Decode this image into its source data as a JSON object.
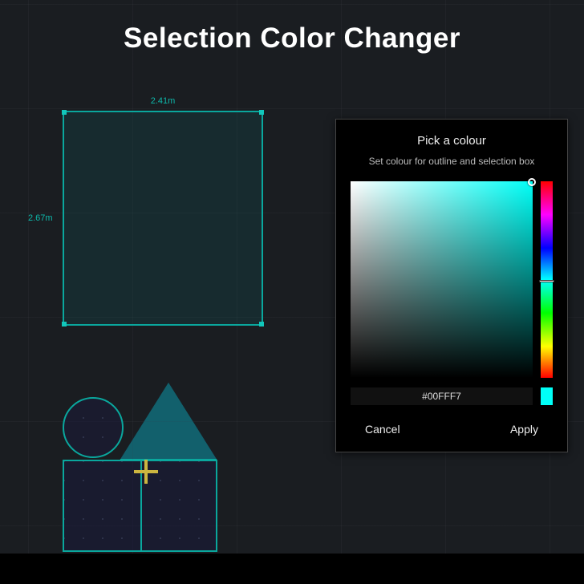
{
  "title": "Selection Color Changer",
  "canvas": {
    "selection": {
      "width_label": "2.41m",
      "height_label": "2.67m"
    },
    "accent_color": "#0aa79d"
  },
  "picker": {
    "title": "Pick a colour",
    "description": "Set colour for outline and selection box",
    "hex_value": "#00FFF7",
    "swatch_color": "#00FFF7",
    "cancel_label": "Cancel",
    "apply_label": "Apply"
  }
}
